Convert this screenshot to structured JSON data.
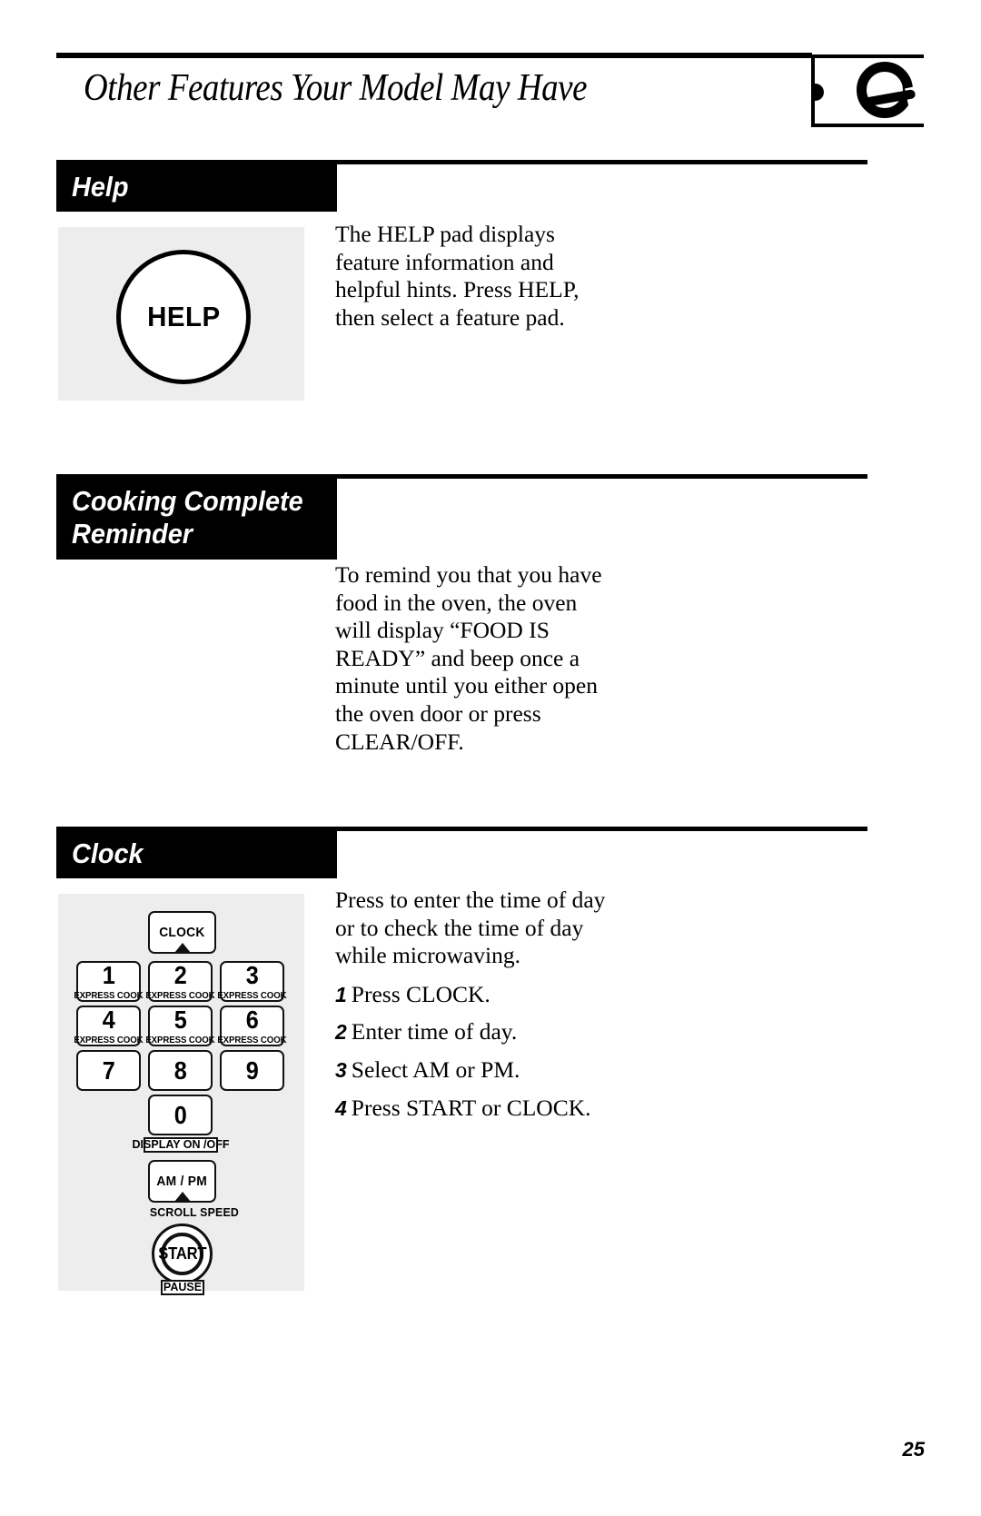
{
  "document": {
    "title": "Other Features Your Model May Have",
    "page_number": "25",
    "thumb_tab_icon": "dial-knob-icon"
  },
  "sections": [
    {
      "id": "help",
      "heading_lines": [
        "Help"
      ],
      "paragraphs": [
        "The HELP pad displays feature information and helpful hints. Press HELP, then select a feature pad."
      ],
      "graphic": {
        "type": "help-pad",
        "button_label": "HELP"
      }
    },
    {
      "id": "cooking-complete-reminder",
      "heading_lines": [
        "Cooking Complete",
        "Reminder"
      ],
      "paragraphs": [
        "To remind you that you have food in the oven, the oven will display “FOOD IS READY” and beep once a minute until you either open the oven door or press CLEAR/OFF."
      ],
      "graphic": null
    },
    {
      "id": "clock",
      "heading_lines": [
        "Clock"
      ],
      "paragraphs": [
        "Press to enter the time of day or to check the time of day while microwaving."
      ],
      "steps": [
        {
          "number": "1",
          "text": "Press CLOCK."
        },
        {
          "number": "2",
          "text": "Enter time of day."
        },
        {
          "number": "3",
          "text": "Select AM or PM."
        },
        {
          "number": "4",
          "text": "Press START or CLOCK."
        }
      ],
      "graphic": {
        "type": "keypad",
        "clock_key": {
          "label": "CLOCK",
          "has_arrow": true
        },
        "number_keys": [
          {
            "digit": "1",
            "sub": "EXPRESS COOK"
          },
          {
            "digit": "2",
            "sub": "EXPRESS COOK"
          },
          {
            "digit": "3",
            "sub": "EXPRESS COOK"
          },
          {
            "digit": "4",
            "sub": "EXPRESS COOK"
          },
          {
            "digit": "5",
            "sub": "EXPRESS COOK"
          },
          {
            "digit": "6",
            "sub": "EXPRESS COOK"
          },
          {
            "digit": "7",
            "sub": ""
          },
          {
            "digit": "8",
            "sub": ""
          },
          {
            "digit": "9",
            "sub": ""
          }
        ],
        "zero_key": {
          "digit": "0"
        },
        "display_label": "DISPLAY ON /OFF",
        "ampm_key": {
          "label": "AM / PM",
          "has_arrow": true
        },
        "scroll_label": "SCROLL SPEED",
        "start_key": {
          "label": "START"
        },
        "pause_label": "PAUSE"
      }
    }
  ]
}
